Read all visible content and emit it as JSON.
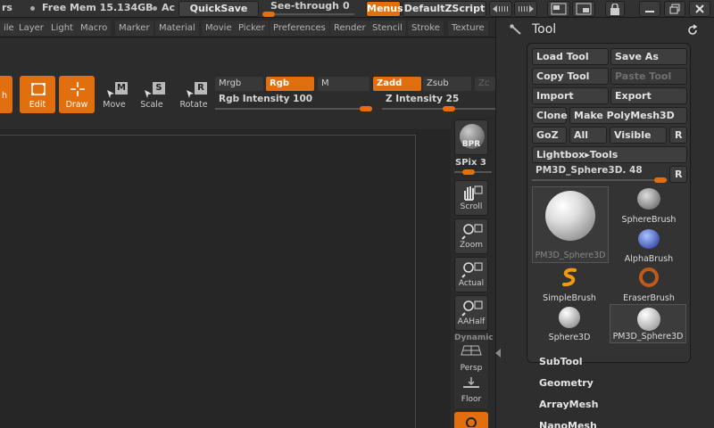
{
  "titlebar": {
    "left_fragment": "rs",
    "free_mem": "Free Mem 15.134GB",
    "active_fragment": "Ac",
    "quicksave": "QuickSave",
    "see_through_label": "See-through",
    "see_through_value": "0",
    "menus": "Menus",
    "script": "DefaultZScript"
  },
  "menubar": {
    "items": [
      "ile",
      "Layer",
      "Light",
      "Macro",
      "Marker",
      "Material",
      "Movie",
      "Picker",
      "Preferences",
      "Render",
      "Stencil",
      "Stroke",
      "Texture"
    ]
  },
  "shelf": {
    "left_fragment": "h",
    "edit": "Edit",
    "draw": "Draw",
    "move": "Move",
    "scale": "Scale",
    "rotate": "Rotate",
    "move_key": "M",
    "scale_key": "S",
    "rotate_key": "R",
    "mrgb": "Mrgb",
    "rgb": "Rgb",
    "m": "M",
    "zadd": "Zadd",
    "zsub": "Zsub",
    "zcut_fragment": "Zc",
    "rgb_intensity": "Rgb Intensity 100",
    "z_intensity": "Z Intensity 25",
    "rgb_intensity_level": 1.0,
    "z_intensity_level": 0.25
  },
  "rstrip": {
    "bpr": "BPR",
    "spix": "SPix 3",
    "scroll": "Scroll",
    "zoom": "Zoom",
    "actual": "Actual",
    "aahalf": "AAHalf",
    "dynamic": "Dynamic",
    "persp": "Persp",
    "floor": "Floor"
  },
  "tool_panel": {
    "title": "Tool",
    "load_tool": "Load Tool",
    "save_as": "Save As",
    "copy_tool": "Copy Tool",
    "paste_tool": "Paste Tool",
    "import": "Import",
    "export": "Export",
    "clone": "Clone",
    "make_polymesh": "Make PolyMesh3D",
    "goz": "GoZ",
    "all": "All",
    "visible": "Visible",
    "r": "R",
    "lightbox_tools": "Lightbox▸Tools",
    "current_tool": "PM3D_Sphere3D. 48",
    "current_tool_r": "R",
    "thumbs": {
      "main": "PM3D_Sphere3D",
      "sphere_brush": "SphereBrush",
      "alpha_brush": "AlphaBrush",
      "simple_brush": "SimpleBrush",
      "eraser_brush": "EraserBrush",
      "sphere3d": "Sphere3D",
      "pm3d_sphere3d": "PM3D_Sphere3D"
    },
    "sections": [
      "SubTool",
      "Geometry",
      "ArrayMesh",
      "NanoMesh"
    ]
  },
  "colors": {
    "accent": "#e26f0e",
    "panel": "#2e2e2e",
    "canvas": "#262626"
  }
}
